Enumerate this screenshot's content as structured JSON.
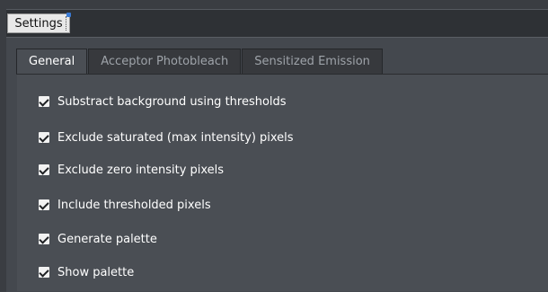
{
  "window": {
    "title_tab": "Settings"
  },
  "tabs": [
    {
      "label": "General",
      "active": true
    },
    {
      "label": "Acceptor Photobleach",
      "active": false
    },
    {
      "label": "Sensitized Emission",
      "active": false
    }
  ],
  "options": [
    {
      "label": "Substract background using thresholds",
      "checked": true
    },
    {
      "label": "Exclude saturated (max intensity) pixels",
      "checked": true
    },
    {
      "label": "Exclude zero intensity pixels",
      "checked": true
    },
    {
      "label": "Include thresholded pixels",
      "checked": true
    },
    {
      "label": "Generate palette",
      "checked": true
    },
    {
      "label": "Show palette",
      "checked": true
    }
  ],
  "colors": {
    "background": "#44484e",
    "panel_active": "#4a4e54",
    "tab_inactive": "#37393d",
    "text_primary": "#ffffff",
    "text_inactive": "#9ea3a9",
    "accent": "#3a7bd5"
  }
}
